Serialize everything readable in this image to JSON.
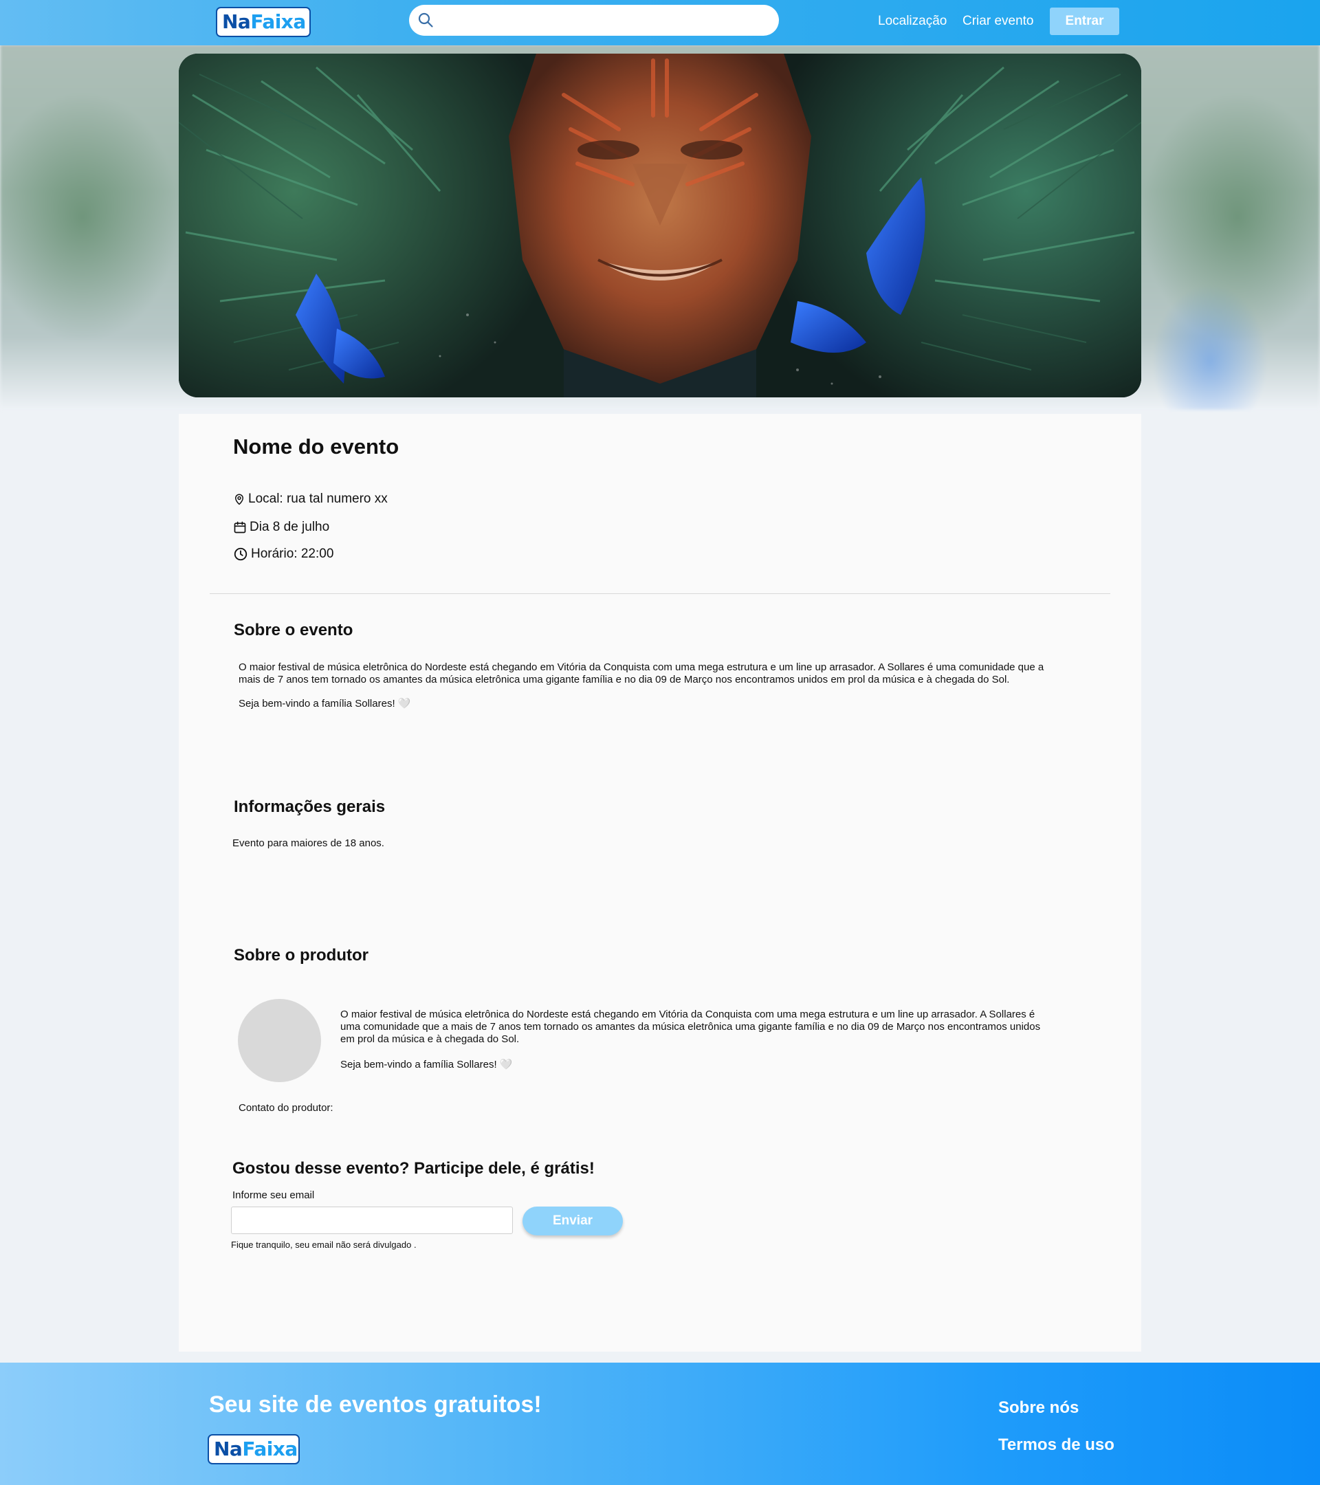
{
  "header": {
    "logo": {
      "part1": "Na",
      "part2": "Faixa"
    },
    "search": {
      "placeholder": "",
      "value": ""
    },
    "nav": [
      "Localização",
      "Criar evento"
    ],
    "login_button": "Entrar"
  },
  "event": {
    "name": "Nome do evento",
    "location": "Local: rua tal numero xx",
    "date": "Dia 8 de julho",
    "time": "Horário: 22:00"
  },
  "about": {
    "title": "Sobre o evento",
    "paragraph1": "O maior festival de música eletrônica do Nordeste está chegando em Vitória da Conquista com uma mega estrutura e um line up arrasador. A Sollares é uma comunidade que a mais de 7 anos tem tornado os amantes da música eletrônica uma gigante família e no dia 09 de Março nos encontramos unidos em prol da música e à chegada do Sol.",
    "paragraph2": "Seja bem-vindo a família Sollares!",
    "heart": "🤍"
  },
  "info": {
    "title": "Informações gerais",
    "text": "Evento para maiores de 18 anos."
  },
  "producer": {
    "title": "Sobre o produtor",
    "paragraph1": "O maior festival de música eletrônica do Nordeste está chegando em Vitória da Conquista com uma mega estrutura e um line up arrasador. A Sollares é uma comunidade que a mais de 7 anos tem tornado os amantes da música eletrônica uma gigante família e no dia 09 de Março nos encontramos unidos em prol da música e à chegada do Sol.",
    "paragraph2": "Seja bem-vindo a família Sollares!",
    "heart": "🤍",
    "contact_label": "Contato do produtor:"
  },
  "signup": {
    "title": "Gostou desse evento? Participe dele, é grátis!",
    "email_label": "Informe seu email",
    "email_value": "",
    "submit_label": "Enviar",
    "note": "Fique tranquilo, seu email não será divulgado ."
  },
  "footer": {
    "tagline": "Seu site de eventos gratuitos!",
    "logo": {
      "part1": "Na",
      "part2": "Faixa"
    },
    "links": [
      "Sobre nós",
      "Termos de uso"
    ]
  },
  "colors": {
    "header_gradient_start": "#63bdf3",
    "header_gradient_end": "#1aa4ee",
    "logo_dark_blue": "#0b4fa6",
    "logo_light_blue": "#1d9ff0",
    "button_light_blue": "#8fd3fb",
    "footer_gradient_end": "#0b8cf8",
    "avatar_placeholder": "#d9d9d9"
  },
  "icons": {
    "search": "search-icon",
    "location": "map-pin-icon",
    "date": "calendar-icon",
    "time": "clock-icon"
  }
}
